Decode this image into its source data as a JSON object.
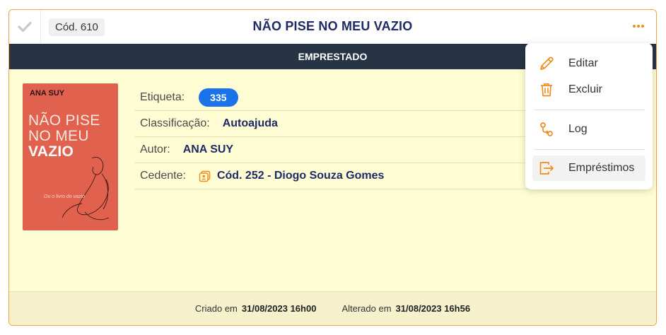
{
  "header": {
    "code": "Cód. 610",
    "title": "NÃO PISE NO MEU VAZIO"
  },
  "status": "EMPRESTADO",
  "cover": {
    "author": "ANA SUY",
    "title_line1": "NÃO PISE",
    "title_line2": "NO MEU",
    "title_line3": "VAZIO",
    "subtitle": "Ou o livro do vazio"
  },
  "details": {
    "etiqueta_label": "Etiqueta:",
    "etiqueta_value": "335",
    "classificacao_label": "Classificação:",
    "classificacao_value": "Autoajuda",
    "autor_label": "Autor:",
    "autor_value": "ANA SUY",
    "cedente_label": "Cedente:",
    "cedente_value": "Cód. 252 - Diogo Souza Gomes"
  },
  "footer": {
    "created_label": "Criado em",
    "created_value": "31/08/2023 16h00",
    "updated_label": "Alterado em",
    "updated_value": "31/08/2023 16h56"
  },
  "menu": {
    "edit": "Editar",
    "delete": "Excluir",
    "log": "Log",
    "loans": "Empréstimos"
  },
  "colors": {
    "accent": "#f28c1a",
    "title": "#1f2a66",
    "status_bar": "#263445",
    "card_bg": "#fffdd3",
    "pill": "#1a73e8"
  }
}
